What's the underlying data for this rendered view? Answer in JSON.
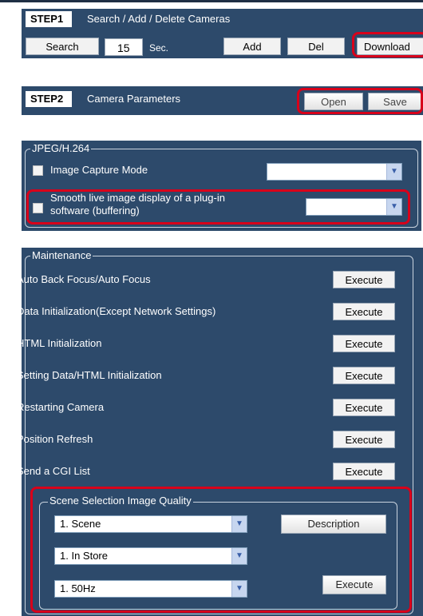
{
  "step1": {
    "badge": "STEP1",
    "title": "Search / Add / Delete Cameras",
    "search_label": "Search",
    "interval_value": "15",
    "interval_unit": "Sec.",
    "add_label": "Add",
    "del_label": "Del",
    "download_label": "Download"
  },
  "step2": {
    "badge": "STEP2",
    "title": "Camera Parameters",
    "open_label": "Open",
    "save_label": "Save"
  },
  "jpeg": {
    "legend": "JPEG/H.264",
    "image_capture_label": "Image Capture Mode",
    "image_capture_value": "",
    "smooth_label_line1": "Smooth live image display of a plug-in",
    "smooth_label_line2": "software (buffering)",
    "smooth_value": ""
  },
  "maintenance": {
    "legend": "Maintenance",
    "execute_label": "Execute",
    "items": [
      {
        "label": "Auto Back Focus/Auto Focus"
      },
      {
        "label": "Data Initialization(Except Network Settings)"
      },
      {
        "label": "HTML Initialization"
      },
      {
        "label": "Setting Data/HTML Initialization"
      },
      {
        "label": "Restarting Camera"
      },
      {
        "label": "Position Refresh"
      },
      {
        "label": "Send a CGI List"
      }
    ]
  },
  "scene": {
    "legend": "Scene Selection Image Quality",
    "scene_value": "1. Scene",
    "location_value": "1. In Store",
    "frequency_value": "1. 50Hz",
    "description_label": "Description",
    "execute_label": "Execute"
  },
  "colors": {
    "panel": "#2d4a6b",
    "highlight": "#d8001a"
  }
}
